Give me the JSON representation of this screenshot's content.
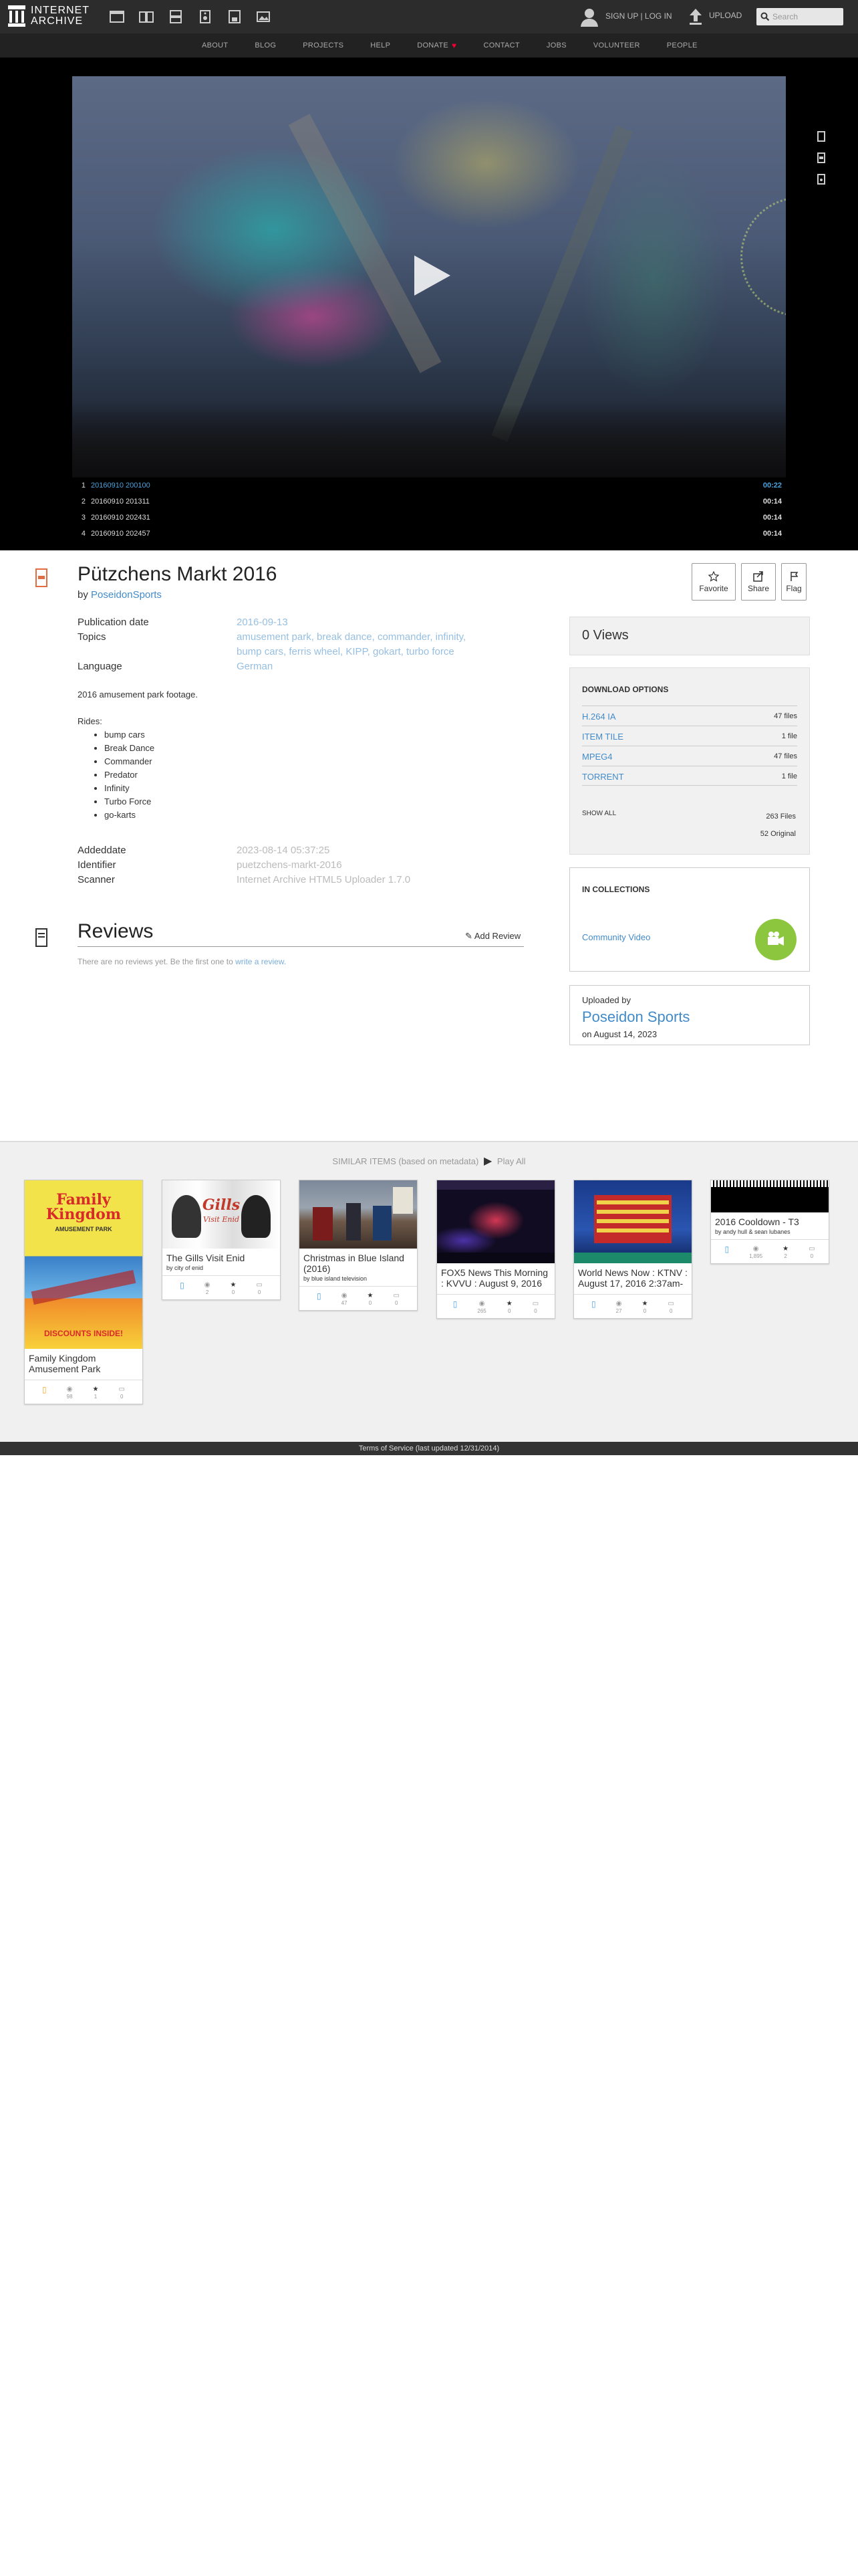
{
  "header": {
    "logo_line1": "INTERNET",
    "logo_line2": "ARCHIVE",
    "signup_label": "SIGN UP | LOG IN",
    "upload_label": "UPLOAD",
    "search_placeholder": "Search",
    "nav": [
      "ABOUT",
      "BLOG",
      "PROJECTS",
      "HELP",
      "DONATE",
      "CONTACT",
      "JOBS",
      "VOLUNTEER",
      "PEOPLE"
    ]
  },
  "player": {
    "playlist": [
      {
        "num": "1",
        "title": "20160910 200100",
        "duration": "00:22"
      },
      {
        "num": "2",
        "title": "20160910 201311",
        "duration": "00:14"
      },
      {
        "num": "3",
        "title": "20160910 202431",
        "duration": "00:14"
      },
      {
        "num": "4",
        "title": "20160910 202457",
        "duration": "00:14"
      }
    ]
  },
  "item": {
    "title": "Pützchens Markt 2016",
    "by_prefix": "by",
    "creator": "PoseidonSports",
    "actions": {
      "favorite": "Favorite",
      "share": "Share",
      "flag": "Flag"
    },
    "labels": {
      "publication_date": "Publication date",
      "topics": "Topics",
      "language": "Language",
      "addeddate": "Addeddate",
      "identifier": "Identifier",
      "scanner": "Scanner"
    },
    "publication_date": "2016-09-13",
    "topics_line1": "amusement park, break dance, commander, infinity,",
    "topics_line2": "bump cars, ferris wheel, KIPP, gokart, turbo force",
    "language": "German",
    "description": "2016 amusement park footage.",
    "rides_label": "Rides:",
    "rides": [
      "bump cars",
      "Break Dance",
      "Commander",
      "Predator",
      "Infinity",
      "Turbo Force",
      "go-karts"
    ],
    "addeddate": "2023-08-14 05:37:25",
    "identifier": "puetzchens-markt-2016",
    "scanner": "Internet Archive HTML5 Uploader 1.7.0"
  },
  "reviews": {
    "title": "Reviews",
    "add_label": "Add Review",
    "note_prefix": "There are no reviews yet. Be the first one to",
    "note_link": "write a review."
  },
  "sidebar": {
    "views": "0 Views",
    "download_title": "DOWNLOAD OPTIONS",
    "downloads": [
      {
        "format": "H.264 IA",
        "count": "47 files"
      },
      {
        "format": "ITEM TILE",
        "count": "1 file"
      },
      {
        "format": "MPEG4",
        "count": "47 files"
      },
      {
        "format": "TORRENT",
        "count": "1 file"
      }
    ],
    "show_all": "SHOW ALL",
    "total_files": "263 Files",
    "original_files": "52 Original",
    "collections_title": "IN COLLECTIONS",
    "collection": "Community Video",
    "uploaded_by_label": "Uploaded by",
    "uploader": "Poseidon Sports",
    "uploaded_on": "on August 14, 2023"
  },
  "similar": {
    "heading": "SIMILAR ITEMS (based on metadata)",
    "play_all": "Play All",
    "tiles": [
      {
        "title": "Family Kingdom Amusement Park",
        "by": "",
        "views": "98",
        "favs": "1",
        "reviews": "0"
      },
      {
        "title": "The Gills Visit Enid",
        "by": "by city of enid",
        "views": "2",
        "favs": "0",
        "reviews": "0"
      },
      {
        "title": "Christmas in Blue Island (2016)",
        "by": "by blue island television",
        "views": "47",
        "favs": "0",
        "reviews": "0"
      },
      {
        "title": "FOX5 News This Morning : KVVU : August 9, 2016",
        "by": "",
        "views": "265",
        "favs": "0",
        "reviews": "0"
      },
      {
        "title": "World News Now : KTNV : August 17, 2016 2:37am-",
        "by": "",
        "views": "27",
        "favs": "0",
        "reviews": "0"
      },
      {
        "title": "2016 Cooldown - T3",
        "by": "by andy hull & sean lubanes",
        "views": "1,895",
        "favs": "2",
        "reviews": "0"
      }
    ],
    "thumb_texts": {
      "family_kingdom_line1": "Family",
      "family_kingdom_line2": "Kingdom",
      "family_kingdom_sub": "AMUSEMENT PARK",
      "family_kingdom_discount": "DISCOUNTS INSIDE!",
      "gills": "Gills",
      "gills_sub": "Visit Enid"
    }
  },
  "footer": {
    "text": "Terms of Service (last updated 12/31/2014)"
  }
}
